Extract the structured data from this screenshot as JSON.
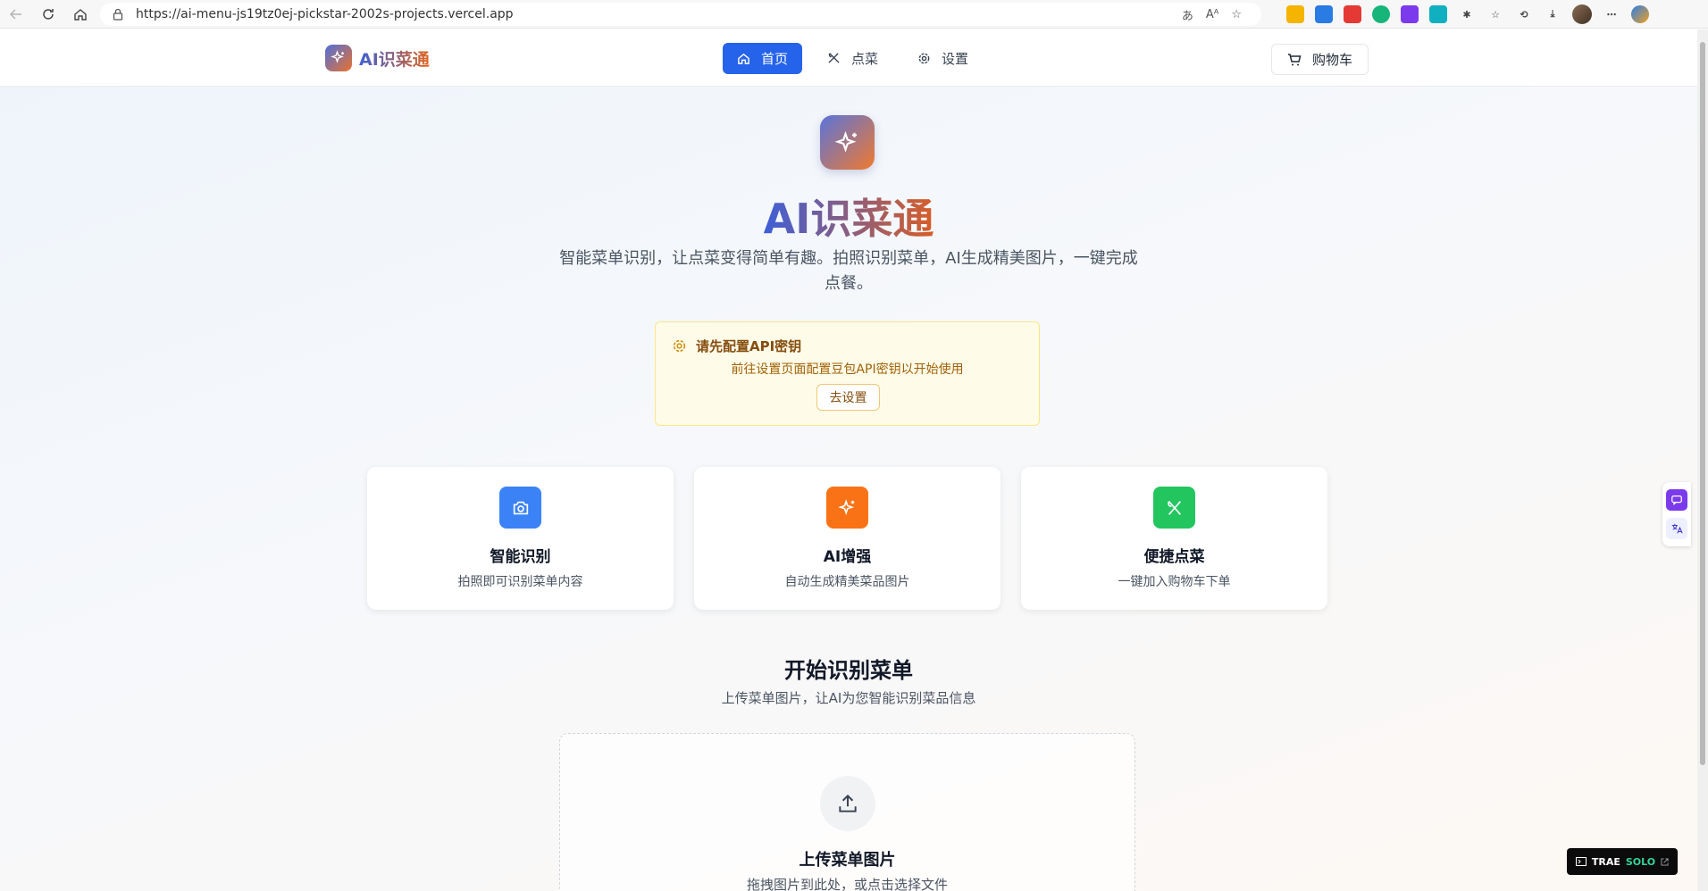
{
  "browser": {
    "url": "https://ai-menu-js19tz0ej-pickstar-2002s-projects.vercel.app",
    "zoom_indicator": "Aᴬ"
  },
  "header": {
    "logo_text": "AI识菜通",
    "nav": [
      {
        "label": "首页",
        "icon": "home-icon",
        "active": true
      },
      {
        "label": "点菜",
        "icon": "utensils-icon",
        "active": false
      },
      {
        "label": "设置",
        "icon": "gear-icon",
        "active": false
      }
    ],
    "cart_label": "购物车"
  },
  "hero": {
    "title": "AI识菜通",
    "subtitle": "智能菜单识别，让点菜变得简单有趣。拍照识别菜单，AI生成精美图片，一键完成点餐。"
  },
  "notice": {
    "title": "请先配置API密钥",
    "body": "前往设置页面配置豆包API密钥以开始使用",
    "button": "去设置"
  },
  "features": [
    {
      "title": "智能识别",
      "desc": "拍照即可识别菜单内容",
      "icon": "camera-icon",
      "color": "#3b82f6"
    },
    {
      "title": "AI增强",
      "desc": "自动生成精美菜品图片",
      "icon": "sparkles-icon",
      "color": "#f97316"
    },
    {
      "title": "便捷点菜",
      "desc": "一键加入购物车下单",
      "icon": "utensils-icon",
      "color": "#22c55e"
    }
  ],
  "section": {
    "title": "开始识别菜单",
    "subtitle": "上传菜单图片，让AI为您智能识别菜品信息"
  },
  "upload": {
    "title": "上传菜单图片",
    "desc": "拖拽图片到此处，或点击选择文件"
  },
  "badge": {
    "brand": "TRAE",
    "product": "SOLO"
  },
  "colors": {
    "primary": "#2563eb",
    "warning_bg": "#fefbe8",
    "warning_border": "#fde68a"
  }
}
